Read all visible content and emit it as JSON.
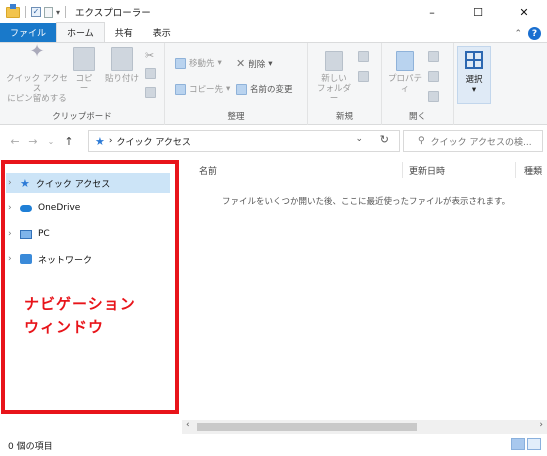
{
  "window": {
    "title": "エクスプローラー",
    "controls": {
      "minimize": "–",
      "maximize": "☐",
      "close": "✕"
    }
  },
  "ribbon_tabs": [
    "ファイル",
    "ホーム",
    "共有",
    "表示"
  ],
  "ribbon": {
    "clipboard": {
      "label": "クリップボード",
      "pin": "クイック アクセス\nにピン留めする",
      "copy": "コピー",
      "paste": "貼り付け"
    },
    "organize": {
      "label": "整理",
      "move_to": "移動先",
      "copy_to": "コピー先",
      "delete": "削除",
      "rename": "名前の変更"
    },
    "new": {
      "label": "新規",
      "new_folder": "新しい\nフォルダー"
    },
    "open": {
      "label": "開く",
      "properties": "プロパティ"
    },
    "select": {
      "label": "選択"
    }
  },
  "address_bar": {
    "path": "クイック アクセス",
    "search_placeholder": "クイック アクセスの検..."
  },
  "nav_pane": {
    "items": [
      {
        "label": "クイック アクセス",
        "icon": "star-icon",
        "selected": true
      },
      {
        "label": "OneDrive",
        "icon": "cloud-icon",
        "selected": false
      },
      {
        "label": "PC",
        "icon": "computer-icon",
        "selected": false
      },
      {
        "label": "ネットワーク",
        "icon": "network-icon",
        "selected": false
      }
    ],
    "annotation_line1": "ナビゲーション",
    "annotation_line2": "ウィンドウ",
    "annotation_color": "#e8141a"
  },
  "content": {
    "columns": [
      "名前",
      "更新日時",
      "種類"
    ],
    "empty_message": "ファイルをいくつか開いた後、ここに最近使ったファイルが表示されます。"
  },
  "status_bar": {
    "item_count": "0 個の項目"
  }
}
